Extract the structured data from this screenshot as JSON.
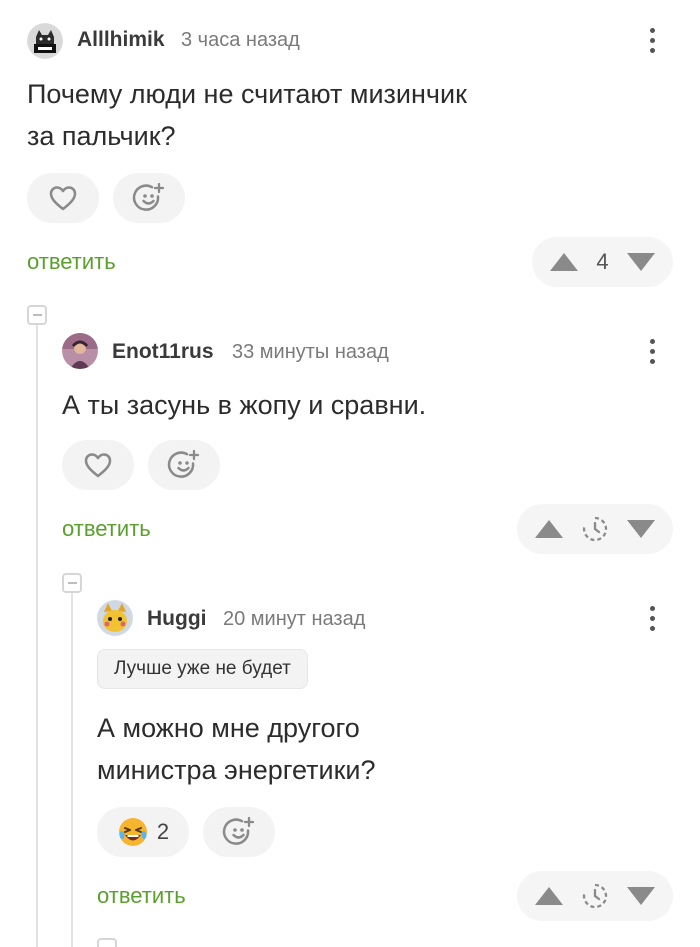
{
  "comments": [
    {
      "author": "Alllhimik",
      "time": "3 часа назад",
      "text_lines": [
        "Почему люди не считают мизинчик",
        "за пальчик?"
      ],
      "reply_label": "ответить",
      "rating": "4"
    },
    {
      "author": "Enot11rus",
      "time": "33 минуты назад",
      "text_lines": [
        "А ты засунь в жопу и сравни."
      ],
      "reply_label": "ответить"
    },
    {
      "author": "Huggi",
      "time": "20 минут назад",
      "tag": "Лучше уже не будет",
      "text_lines": [
        "А можно мне другого",
        "министра энергетики?"
      ],
      "reaction_count": "2",
      "reply_label": "ответить"
    }
  ],
  "colors": {
    "reply_green": "#5aa02c",
    "icon_gray": "#8a8a8a",
    "pill_bg": "#f3f3f3"
  }
}
